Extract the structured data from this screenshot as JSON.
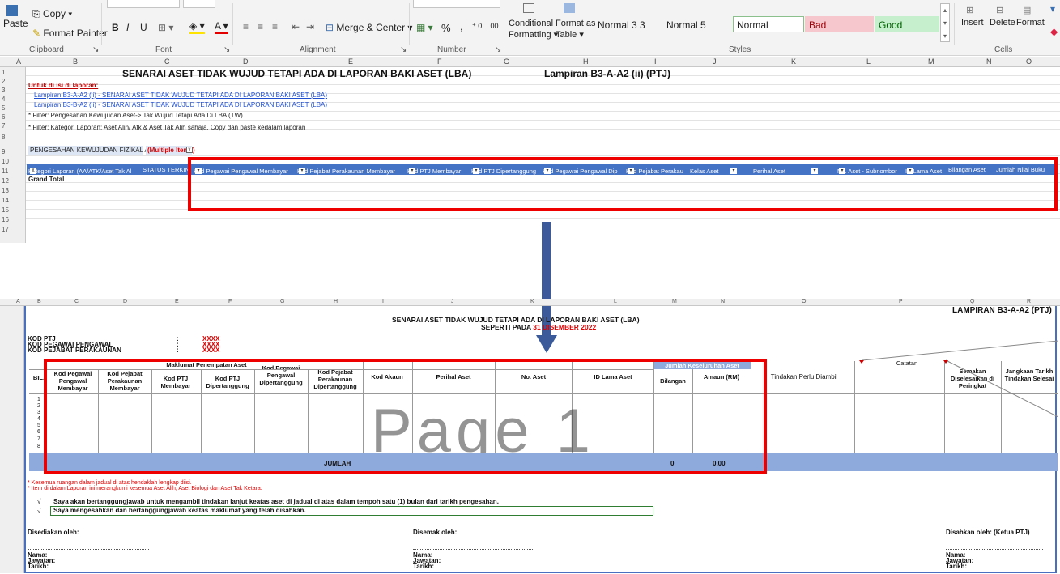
{
  "ribbon": {
    "copy": "Copy",
    "paste": "Paste",
    "format_painter": "Format Painter",
    "bold": "B",
    "italic": "I",
    "underline": "U",
    "merge_center": "Merge & Center",
    "percent": "%",
    "comma": ",",
    "conditional": "Conditional",
    "formatting": "Formatting",
    "format_as": "Format as",
    "table": "Table",
    "styles": [
      "Normal 3 3",
      "Normal 5",
      "Normal",
      "Bad",
      "Good"
    ],
    "insert": "Insert",
    "delete": "Delete",
    "format": "Format",
    "groups": [
      "Clipboard",
      "Font",
      "Alignment",
      "Number",
      "Styles",
      "Cells"
    ]
  },
  "sheet1": {
    "columns": [
      "A",
      "B",
      "C",
      "D",
      "E",
      "F",
      "G",
      "H",
      "I",
      "J",
      "K",
      "L",
      "M",
      "N",
      "O"
    ],
    "rows": [
      "1",
      "2",
      "3",
      "4",
      "5",
      "6",
      "7",
      "8",
      "9",
      "10",
      "11",
      "12",
      "13",
      "14",
      "15",
      "16",
      "17"
    ],
    "title": "SENARAI ASET TIDAK WUJUD TETAPI ADA DI LAPORAN BAKI ASET (LBA)",
    "lampiran": "Lampiran B3-A-A2 (ii) (PTJ)",
    "instruction": "Untuk di isi di laporan:",
    "link1": "Lampiran B3-A-A2 (ii) - SENARAI ASET TIDAK WUJUD TETAPI ADA DI LAPORAN BAKI ASET (LBA)",
    "link2": "Lampiran B3-B-A2 (ii) - SENARAI ASET TIDAK WUJUD TETAPI ADA DI LAPORAN BAKI ASET (LBA)",
    "filter1": "* Filter: Pengesahan Kewujudan Aset-> Tak Wujud Tetapi Ada Di LBA (TW)",
    "filter2": "* Filter: Kategori Laporan: Aset Alih/ Atk & Aset Tak Alih sahaja. Copy dan paste kedalam laporan",
    "pengesahan_label": "PENGESAHAN KEWUJUDAN FIZIKAL ASET",
    "multiple_items": "(Multiple Items)",
    "pivot_headers": [
      "Kategori Laporan (AA/ATK/Aset Tak Al",
      "STATUS TERKINI",
      "Kod Pegawai Pengawal Membayar",
      "Kod Pejabat Perakaunan Membayar",
      "Kod PTJ Membayar",
      "Kod PTJ Dipertanggung",
      "Kod Pegawai Pengawal Dip",
      "Kod Pejabat Perakau",
      "Kelas Aset",
      "Perihal Aset",
      "No. Aset - Subnombor",
      "ID Lama Aset",
      "Bilangan Aset",
      "Jumlah Nilai Buku"
    ],
    "grand_total": "Grand Total"
  },
  "sheet2": {
    "columns": [
      "A",
      "B",
      "C",
      "D",
      "E",
      "F",
      "G",
      "H",
      "I",
      "J",
      "K",
      "L",
      "M",
      "N",
      "O",
      "P",
      "Q",
      "R"
    ],
    "lampiran": "LAMPIRAN B3-A-A2 (PTJ)",
    "title": "SENARAI ASET TIDAK WUJUD TETAPI ADA DI LAPORAN BAKI ASET (LBA)",
    "subtitle_prefix": "SEPERTI PADA",
    "subtitle_date": "31 DISEMBER 2022",
    "kod_ptj": "KOD PTJ",
    "kod_pegawai": "KOD PEGAWAI PENGAWAL",
    "kod_pejabat": "KOD PEJABAT PERAKAUNAN",
    "colon": ":",
    "xxxx": "XXXX",
    "maklumat": "Maklumat Penempatan Aset",
    "jumlah_keseluruhan": "Jumlah Keseluruhan Aset",
    "catatan": "Catatan",
    "headers": {
      "bil": "BIL.",
      "h1": "Kod Pegawai Pengawal Membayar",
      "h2": "Kod Pejabat Perakaunan Membayar",
      "h3": "Kod PTJ Membayar",
      "h4": "Kod PTJ Dipertanggung",
      "h5": "Kod Pegawai Pengawal Dipertanggung",
      "h6": "Kod Pejabat Perakaunan Dipertanggung",
      "h7": "Kod Akaun",
      "h8": "Perihal Aset",
      "h9": "No. Aset",
      "h10": "ID Lama Aset",
      "h11": "Bilangan",
      "h12": "Amaun (RM)",
      "h13": "Tindakan Perlu Diambil",
      "h14": "Semakan Diselesaikan di Peringkat",
      "h15": "Jangkaan Tarikh Tindakan Selesai"
    },
    "rows": [
      "1",
      "2",
      "3",
      "4",
      "5",
      "6",
      "7",
      "8"
    ],
    "jumlah": "JUMLAH",
    "jumlah_bil": "0",
    "jumlah_amaun": "0.00",
    "watermark": "Page 1",
    "note1": "* Kesemua ruangan dalam jadual di atas hendaklah lengkap diisi.",
    "note2": "* Item di dalam Laporan ini merangkumi kesemua Aset Alih, Aset Biologi dan Aset Tak Ketara.",
    "check": "√",
    "stmt1": "Saya akan bertanggungjawab untuk mengambil tindakan lanjut keatas aset di jadual di atas dalam tempoh satu (1) bulan dari tarikh pengesahan.",
    "stmt2": "Saya mengesahkan dan bertanggungjawab keatas maklumat yang telah disahkan.",
    "disediakan": "Disediakan oleh:",
    "disemak": "Disemak oleh:",
    "disahkan": "Disahkan oleh: (Ketua PTJ)",
    "nama": "Nama:",
    "jawatan": "Jawatan:",
    "tarikh": "Tarikh:"
  }
}
